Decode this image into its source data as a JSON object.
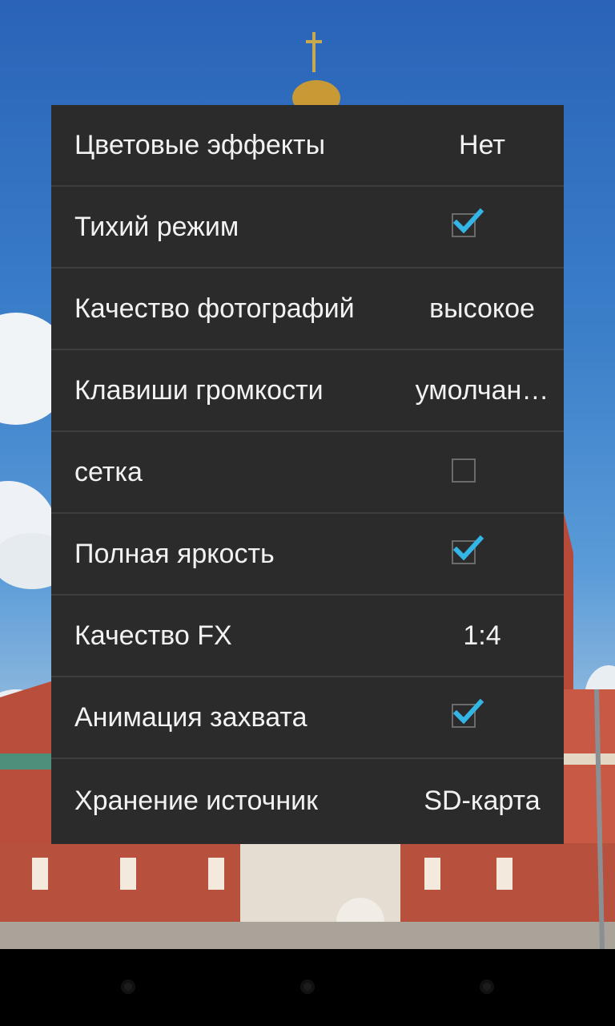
{
  "settings": {
    "items": [
      {
        "label": "Цветовые эффекты",
        "type": "value",
        "value": "Нет"
      },
      {
        "label": "Тихий режим",
        "type": "checkbox",
        "checked": true
      },
      {
        "label": "Качество фотографий",
        "type": "value",
        "value": "высокое"
      },
      {
        "label": "Клавиши громкости",
        "type": "value",
        "value": "умолчан…"
      },
      {
        "label": "сетка",
        "type": "checkbox",
        "checked": false
      },
      {
        "label": "Полная яркость",
        "type": "checkbox",
        "checked": true
      },
      {
        "label": "Качество FX",
        "type": "value",
        "value": "1:4"
      },
      {
        "label": "Анимация захвата",
        "type": "checkbox",
        "checked": true
      },
      {
        "label": "Хранение источник",
        "type": "value",
        "value": "SD-карта"
      }
    ]
  },
  "navbar": {
    "buttons": [
      "back-button",
      "home-button",
      "recents-button"
    ]
  },
  "colors": {
    "popup_bg": "#2b2b2b",
    "divider": "#3e3e3e",
    "text": "#f2f2f2",
    "check_accent": "#33b5e5"
  }
}
